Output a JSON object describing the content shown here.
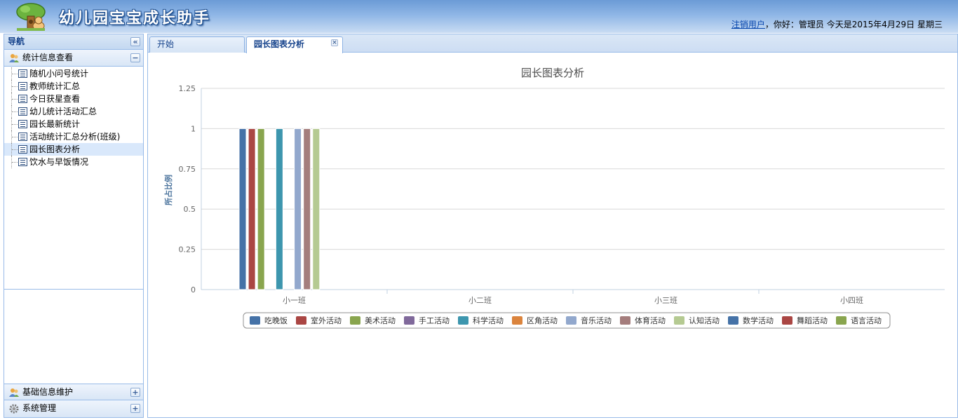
{
  "header": {
    "app_title": "幼儿园宝宝成长助手",
    "logout_link": "注销用户",
    "greeting": "，你好：管理员 今天是2015年4月29日 星期三"
  },
  "nav": {
    "title": "导航",
    "sections": [
      {
        "label": "统计信息查看",
        "expanded": true
      },
      {
        "label": "基础信息维护",
        "expanded": false
      },
      {
        "label": "系统管理",
        "expanded": false
      }
    ],
    "items": [
      {
        "label": "随机小问号统计"
      },
      {
        "label": "教师统计汇总"
      },
      {
        "label": "今日获星查看"
      },
      {
        "label": "幼儿统计活动汇总"
      },
      {
        "label": "园长最新统计"
      },
      {
        "label": "活动统计汇总分析(班级)"
      },
      {
        "label": "园长图表分析",
        "selected": true
      },
      {
        "label": "饮水与早饭情况"
      }
    ]
  },
  "tabs": [
    {
      "label": "开始",
      "active": false
    },
    {
      "label": "园长图表分析",
      "active": true,
      "closable": true
    }
  ],
  "chart_data": {
    "type": "bar",
    "title": "园长图表分析",
    "xlabel": "",
    "ylabel": "所占比例",
    "ylim": [
      0,
      1.25
    ],
    "yticks": [
      "0",
      "0.25",
      "0.5",
      "0.75",
      "1",
      "1.25"
    ],
    "grid": true,
    "legend_position": "bottom",
    "categories": [
      "小一班",
      "小二班",
      "小三班",
      "小四班"
    ],
    "series": [
      {
        "name": "吃晚饭",
        "color": "#4572a7",
        "values": [
          1,
          0,
          0,
          0
        ]
      },
      {
        "name": "室外活动",
        "color": "#aa4643",
        "values": [
          1,
          0,
          0,
          0
        ]
      },
      {
        "name": "美术活动",
        "color": "#89a54e",
        "values": [
          1,
          0,
          0,
          0
        ]
      },
      {
        "name": "手工活动",
        "color": "#80699b",
        "values": [
          0,
          0,
          0,
          0
        ]
      },
      {
        "name": "科学活动",
        "color": "#3d96ae",
        "values": [
          1,
          0,
          0,
          0
        ]
      },
      {
        "name": "区角活动",
        "color": "#db843d",
        "values": [
          0,
          0,
          0,
          0
        ]
      },
      {
        "name": "音乐活动",
        "color": "#92a8cd",
        "values": [
          1,
          0,
          0,
          0
        ]
      },
      {
        "name": "体育活动",
        "color": "#a47d7c",
        "values": [
          1,
          0,
          0,
          0
        ]
      },
      {
        "name": "认知活动",
        "color": "#b5ca92",
        "values": [
          1,
          0,
          0,
          0
        ]
      },
      {
        "name": "数学活动",
        "color": "#4572a7",
        "values": [
          0,
          0,
          0,
          0
        ]
      },
      {
        "name": "舞蹈活动",
        "color": "#aa4643",
        "values": [
          0,
          0,
          0,
          0
        ]
      },
      {
        "name": "语言活动",
        "color": "#89a54e",
        "values": [
          0,
          0,
          0,
          0
        ]
      }
    ]
  }
}
